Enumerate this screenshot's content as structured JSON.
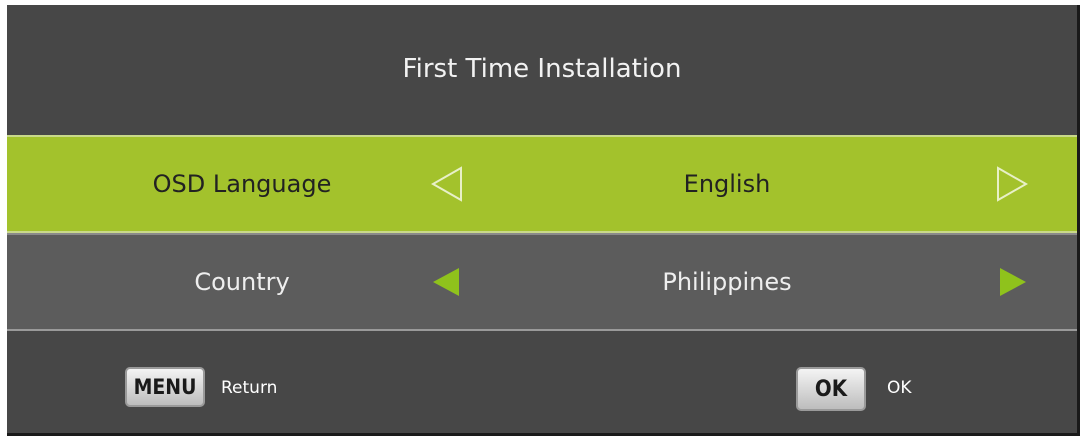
{
  "title": "First Time Installation",
  "rows": [
    {
      "label": "OSD Language",
      "value": "English"
    },
    {
      "label": "Country",
      "value": "Philippines"
    }
  ],
  "footer": {
    "menu_key": "MENU",
    "menu_action": "Return",
    "ok_key": "OK",
    "ok_action": "OK"
  },
  "colors": {
    "panel": "#474747",
    "selected_row": "#a3c22c",
    "unselected_row": "#5c5c5c",
    "arrow_green": "#8fc21c"
  }
}
